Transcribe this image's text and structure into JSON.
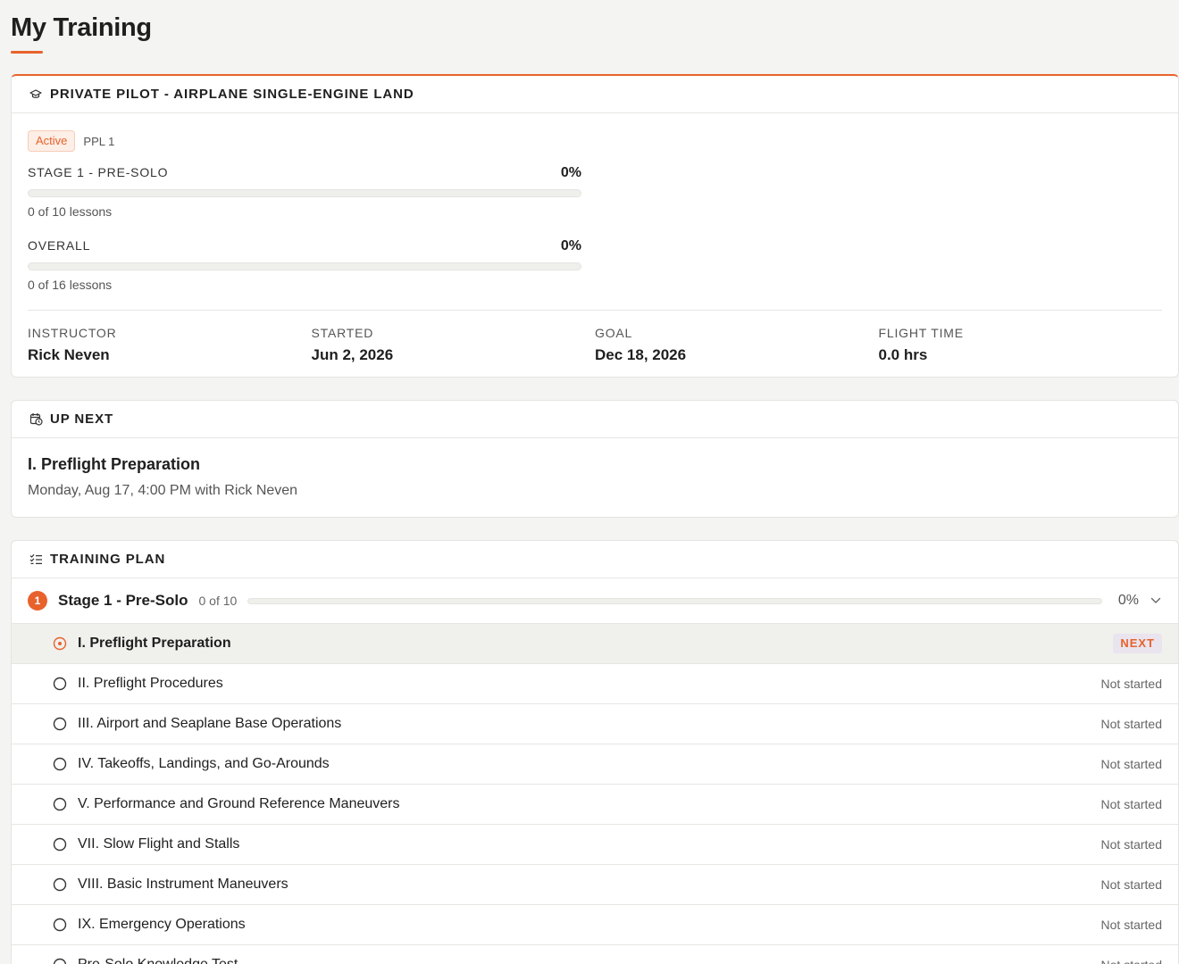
{
  "page": {
    "title": "My Training"
  },
  "program": {
    "title": "PRIVATE PILOT - AIRPLANE SINGLE-ENGINE LAND",
    "status_badge": "Active",
    "code": "PPL 1",
    "stage_progress": {
      "label": "STAGE 1 - PRE-SOLO",
      "percent_text": "0%",
      "percent": 0,
      "subtext": "0 of 10 lessons"
    },
    "overall_progress": {
      "label": "OVERALL",
      "percent_text": "0%",
      "percent": 0,
      "subtext": "0 of 16 lessons"
    },
    "meta": [
      {
        "label": "INSTRUCTOR",
        "value": "Rick Neven"
      },
      {
        "label": "STARTED",
        "value": "Jun 2, 2026"
      },
      {
        "label": "GOAL",
        "value": "Dec 18, 2026"
      },
      {
        "label": "FLIGHT TIME",
        "value": "0.0 hrs"
      }
    ]
  },
  "up_next": {
    "header": "UP NEXT",
    "lesson_title": "I. Preflight Preparation",
    "details": "Monday, Aug 17, 4:00 PM with Rick Neven"
  },
  "training_plan": {
    "header": "TRAINING PLAN",
    "stage": {
      "number": "1",
      "name": "Stage 1 - Pre-Solo",
      "count": "0 of 10",
      "percent_text": "0%",
      "percent": 0
    },
    "lessons": [
      {
        "name": "I. Preflight Preparation",
        "status": "NEXT",
        "active": true
      },
      {
        "name": "II. Preflight Procedures",
        "status": "Not started"
      },
      {
        "name": "III. Airport and Seaplane Base Operations",
        "status": "Not started"
      },
      {
        "name": "IV. Takeoffs, Landings, and Go-Arounds",
        "status": "Not started"
      },
      {
        "name": "V. Performance and Ground Reference Maneuvers",
        "status": "Not started"
      },
      {
        "name": "VII. Slow Flight and Stalls",
        "status": "Not started"
      },
      {
        "name": "VIII. Basic Instrument Maneuvers",
        "status": "Not started"
      },
      {
        "name": "IX. Emergency Operations",
        "status": "Not started"
      },
      {
        "name": "Pre-Solo Knowledge Test",
        "status": "Not started"
      }
    ]
  },
  "colors": {
    "accent": "#e8622c",
    "background": "#f4f4f2",
    "next_badge_bg": "#e9e4ee"
  },
  "icons": {
    "program": "graduation-cap-icon",
    "up_next": "calendar-clock-icon",
    "plan": "checklist-icon",
    "stage_toggle": "chevron-down-icon",
    "lesson_pending": "circle-icon",
    "lesson_current": "target-circle-icon"
  }
}
